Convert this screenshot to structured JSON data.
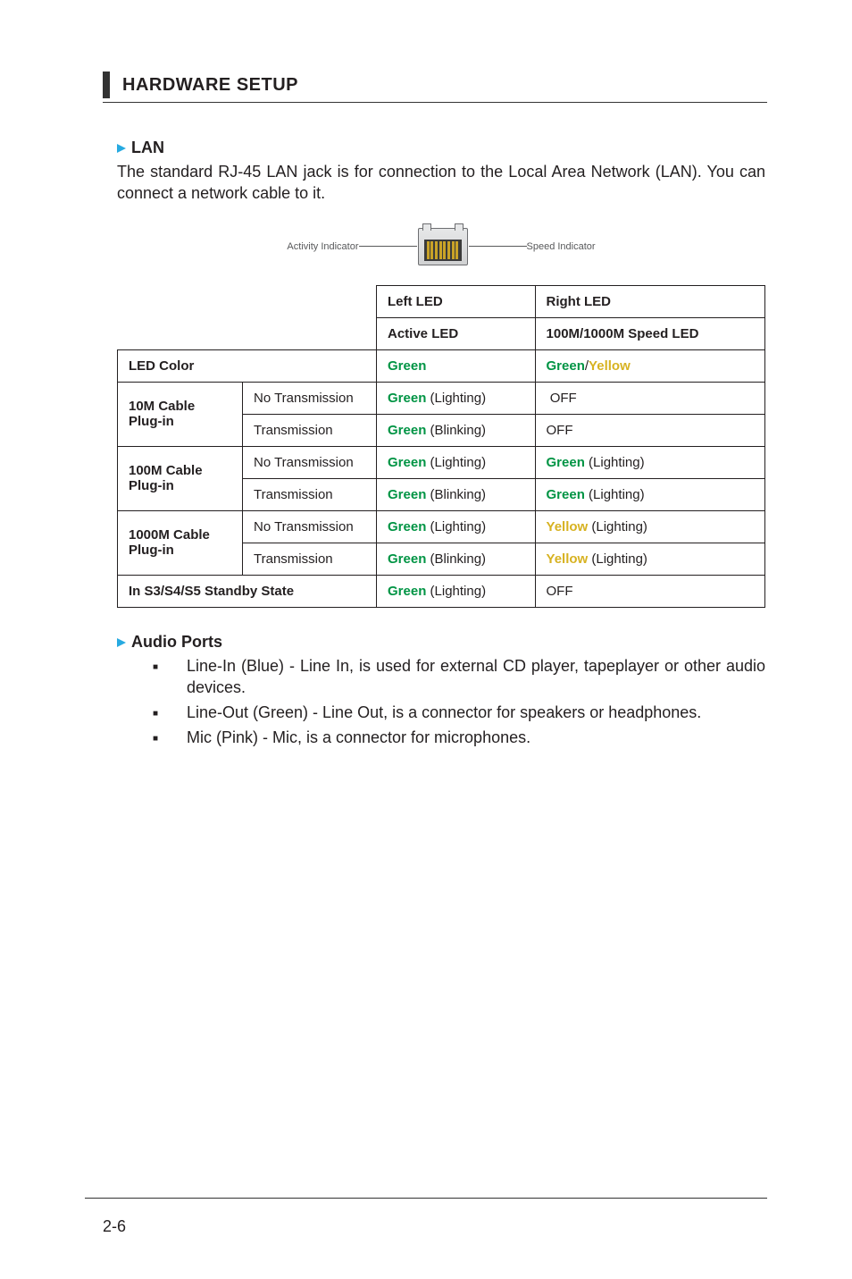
{
  "header": {
    "title": "HARDWARE SETUP"
  },
  "lan": {
    "heading": "LAN",
    "body": "The standard RJ-45 LAN jack is for connection to the Local Area Network (LAN). You can connect a network cable to it.",
    "diagram": {
      "left_label": "Activity Indicator",
      "right_label": "Speed Indicator"
    }
  },
  "table": {
    "hdr_left_led": "Left LED",
    "hdr_right_led": "Right LED",
    "hdr_active_led": "Active LED",
    "hdr_speed_led": "100M/1000M Speed LED",
    "row_led_color": "LED Color",
    "led_color_left": "Green",
    "led_color_right_a": "Green",
    "led_color_right_slash": "/",
    "led_color_right_b": "Yellow",
    "r10": "10M Cable Plug-in",
    "r100": "100M Cable Plug-in",
    "r1000": "1000M Cable Plug-in",
    "no_tx": "No Transmission",
    "tx": "Transmission",
    "g_lighting_pre": "Green",
    "g_lighting_suf": " (Lighting)",
    "g_blinking_pre": "Green",
    "g_blinking_suf": " (Blinking)",
    "y_lighting_pre": "Yellow",
    "y_lighting_suf": " (Lighting)",
    "off": "OFF",
    "standby": "In S3/S4/S5 Standby State"
  },
  "audio": {
    "heading": "Audio Ports",
    "items": [
      "Line-In (Blue) - Line In, is used for external CD player, tapeplayer or other audio devices.",
      "Line-Out (Green) - Line Out, is a connector for speakers or headphones.",
      "Mic (Pink) - Mic, is a connector for microphones."
    ]
  },
  "footer": {
    "page_num": "2-6"
  }
}
